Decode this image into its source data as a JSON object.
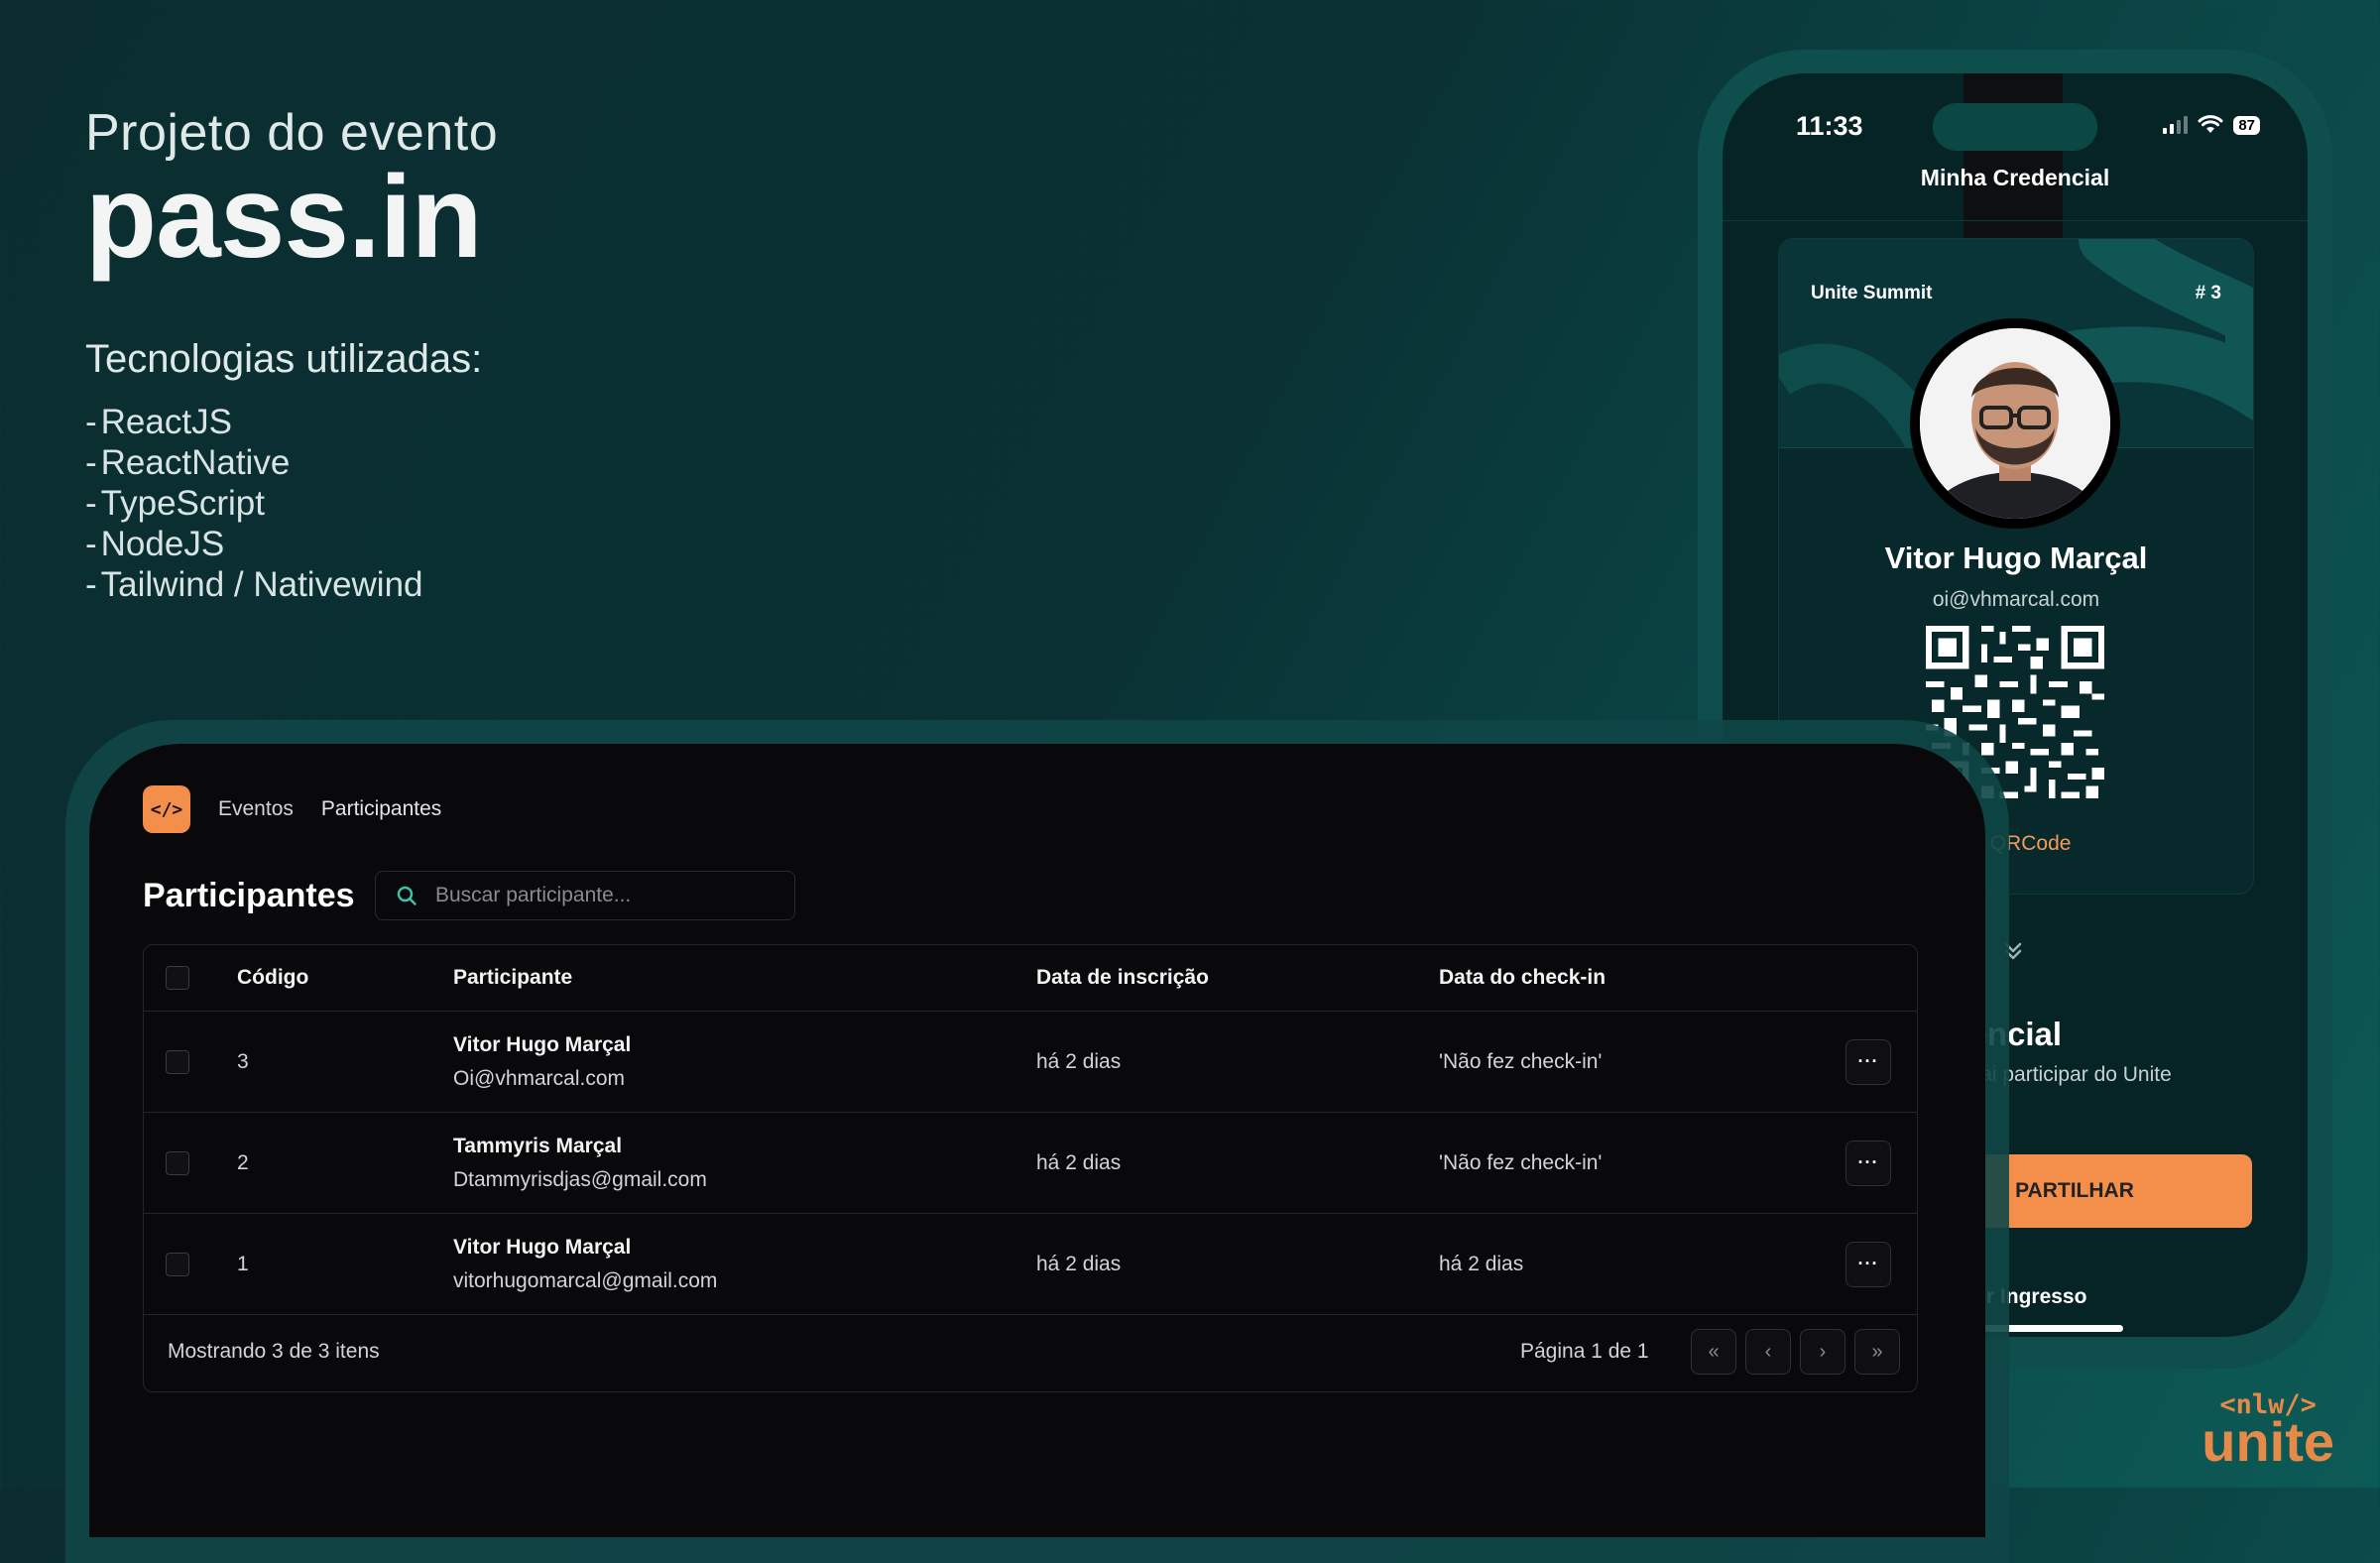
{
  "hero": {
    "kicker": "Projeto do evento",
    "brand": "pass.in",
    "tech_title": "Tecnologias utilizadas:",
    "techs": [
      "ReactJS",
      "ReactNative",
      "TypeScript",
      "NodeJS",
      "Tailwind / Nativewind"
    ],
    "dash": "-"
  },
  "phone": {
    "time": "11:33",
    "battery": "87",
    "title": "Minha Credencial",
    "badge": {
      "event": "Unite Summit",
      "number": "# 3",
      "name": "Vitor Hugo Marçal",
      "email": "oi@vhmarcal.com",
      "qr_link": "iar QRCode"
    },
    "chevron_icon": "chevrons-down-icon",
    "section_title": "edencial",
    "section_desc": "ocê vai participar do Unite",
    "share_button": "PARTILHAR",
    "ticket_link": "ver Ingresso"
  },
  "web": {
    "nav": {
      "logo": "</>",
      "items": [
        "Eventos",
        "Participantes"
      ]
    },
    "page_title": "Participantes",
    "search_placeholder": "Buscar participante...",
    "table": {
      "headers": [
        "Código",
        "Participante",
        "Data de inscrição",
        "Data do check-in"
      ],
      "rows": [
        {
          "code": "3",
          "name": "Vitor Hugo Marçal",
          "email": "Oi@vhmarcal.com",
          "created": "há 2 dias",
          "checkin": "'Não fez check-in'"
        },
        {
          "code": "2",
          "name": "Tammyris Marçal",
          "email": "Dtammyrisdjas@gmail.com",
          "created": "há 2 dias",
          "checkin": "'Não fez check-in'"
        },
        {
          "code": "1",
          "name": "Vitor Hugo Marçal",
          "email": "vitorhugomarcal@gmail.com",
          "created": "há 2 dias",
          "checkin": "há 2 dias"
        }
      ],
      "row_action_icon": "more-horizontal-icon",
      "row_action_label": "···"
    },
    "footer": {
      "showing": "Mostrando 3 de 3 itens",
      "page_info": "Página 1 de 1",
      "pager": [
        "«",
        "‹",
        "›",
        "»"
      ]
    }
  },
  "logo_corner": {
    "line1": "<nlw/>",
    "line2": "unite"
  },
  "colors": {
    "accent": "#f48f4b",
    "background": "#0a3134",
    "app_background": "#09090b"
  }
}
